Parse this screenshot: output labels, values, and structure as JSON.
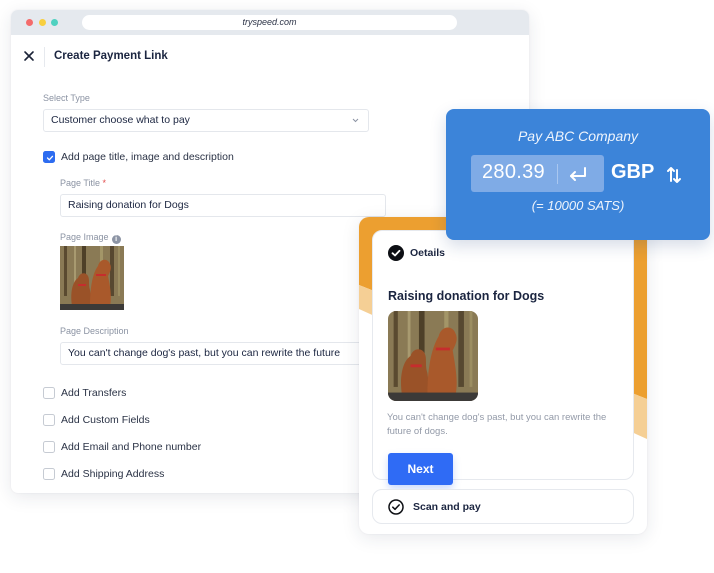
{
  "browser": {
    "url": "tryspeed.com"
  },
  "form": {
    "title": "Create Payment Link",
    "select_type": {
      "label": "Select Type",
      "value": "Customer choose what to pay"
    },
    "page_details_checkbox": {
      "label": "Add page title, image and description",
      "checked": true
    },
    "page_title": {
      "label": "Page Title",
      "required_mark": "*",
      "value": "Raising donation for Dogs"
    },
    "page_image": {
      "label": "Page Image",
      "info_icon": "i"
    },
    "page_description": {
      "label": "Page Description",
      "value": "You can't change dog's past, but you can rewrite the future"
    },
    "options": [
      {
        "label": "Add Transfers",
        "checked": false
      },
      {
        "label": "Add Custom Fields",
        "checked": false
      },
      {
        "label": "Add Email and Phone number",
        "checked": false
      },
      {
        "label": "Add Shipping Address",
        "checked": false
      }
    ]
  },
  "preview": {
    "step_label": "Oetails",
    "title": "Raising donation for Dogs",
    "description": "You can't change dog's past, but you can rewrite the future of dogs.",
    "next_label": "Next",
    "scan_label": "Scan and pay",
    "colors": {
      "band": "#ec9f30",
      "band_light": "#f5cf95",
      "button": "#2f6bf5"
    }
  },
  "pay_box": {
    "pay_to": "Pay ABC Company",
    "amount": "280.39",
    "currency": "GBP",
    "conversion": "(= 10000 SATS)",
    "color": "#3c84d9"
  }
}
